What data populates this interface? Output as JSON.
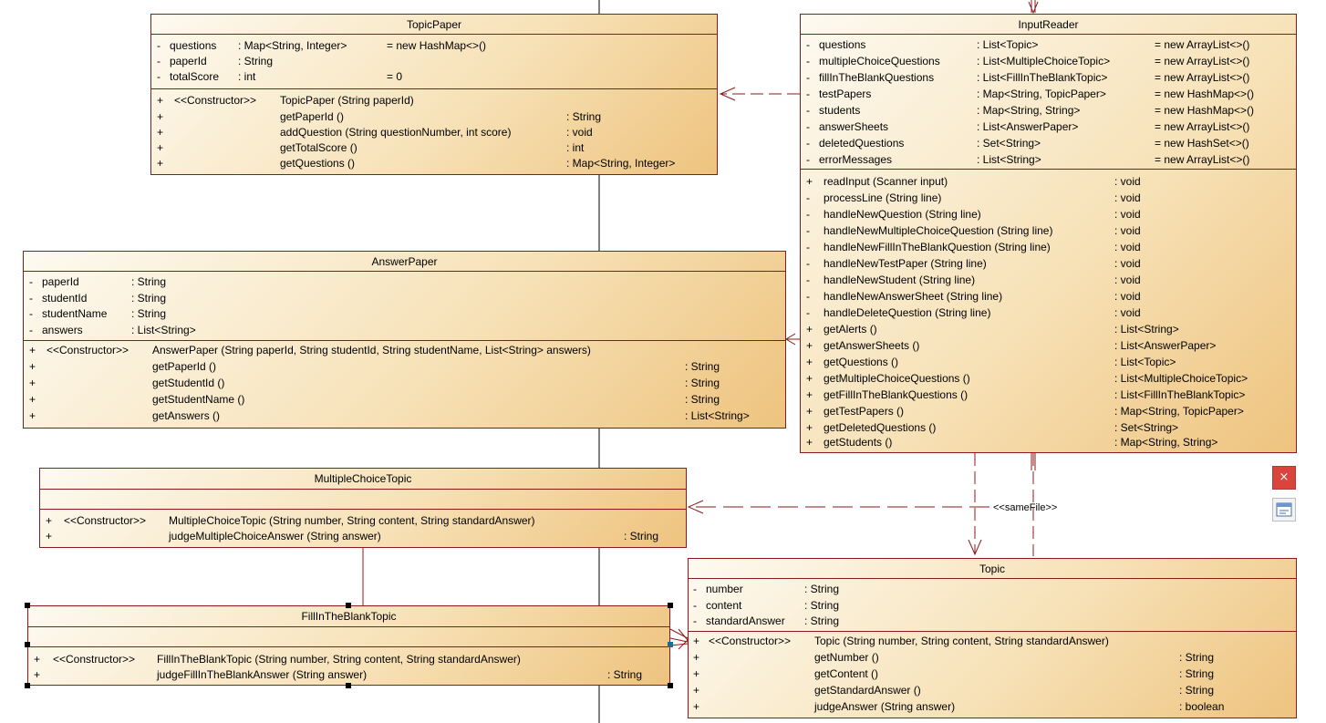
{
  "classes": {
    "topicpaper": {
      "name": "TopicPaper",
      "attributes": [
        {
          "vis": "-",
          "name": "questions",
          "type": ": Map<String, Integer>",
          "init": "= new HashMap<>()"
        },
        {
          "vis": "-",
          "name": "paperId",
          "type": ": String",
          "init": ""
        },
        {
          "vis": "-",
          "name": "totalScore",
          "type": ": int",
          "init": "= 0"
        }
      ],
      "operations": [
        {
          "vis": "+",
          "stereo": "<<Constructor>>",
          "sig": "TopicPaper (String paperId)",
          "ret": ""
        },
        {
          "vis": "+",
          "stereo": "",
          "sig": "getPaperId ()",
          "ret": ": String"
        },
        {
          "vis": "+",
          "stereo": "",
          "sig": "addQuestion (String questionNumber, int score)",
          "ret": ": void"
        },
        {
          "vis": "+",
          "stereo": "",
          "sig": "getTotalScore ()",
          "ret": ": int"
        },
        {
          "vis": "+",
          "stereo": "",
          "sig": "getQuestions ()",
          "ret": ": Map<String, Integer>"
        }
      ]
    },
    "inputreader": {
      "name": "InputReader",
      "attributes": [
        {
          "vis": "-",
          "name": "questions",
          "type": ": List<Topic>",
          "init": "= new ArrayList<>()"
        },
        {
          "vis": "-",
          "name": "multipleChoiceQuestions",
          "type": ": List<MultipleChoiceTopic>",
          "init": "= new ArrayList<>()"
        },
        {
          "vis": "-",
          "name": "fillInTheBlankQuestions",
          "type": ": List<FillInTheBlankTopic>",
          "init": "= new ArrayList<>()"
        },
        {
          "vis": "-",
          "name": "testPapers",
          "type": ": Map<String, TopicPaper>",
          "init": "= new HashMap<>()"
        },
        {
          "vis": "-",
          "name": "students",
          "type": ": Map<String, String>",
          "init": "= new HashMap<>()"
        },
        {
          "vis": "-",
          "name": "answerSheets",
          "type": ": List<AnswerPaper>",
          "init": "= new ArrayList<>()"
        },
        {
          "vis": "-",
          "name": "deletedQuestions",
          "type": ": Set<String>",
          "init": "= new HashSet<>()"
        },
        {
          "vis": "-",
          "name": "errorMessages",
          "type": ": List<String>",
          "init": "= new ArrayList<>()"
        }
      ],
      "operations": [
        {
          "vis": "+",
          "stereo": "",
          "sig": "readInput (Scanner input)",
          "ret": ": void"
        },
        {
          "vis": "-",
          "stereo": "",
          "sig": "processLine (String line)",
          "ret": ": void"
        },
        {
          "vis": "-",
          "stereo": "",
          "sig": "handleNewQuestion (String line)",
          "ret": ": void"
        },
        {
          "vis": "-",
          "stereo": "",
          "sig": "handleNewMultipleChoiceQuestion (String line)",
          "ret": ": void"
        },
        {
          "vis": "-",
          "stereo": "",
          "sig": "handleNewFillInTheBlankQuestion (String line)",
          "ret": ": void"
        },
        {
          "vis": "-",
          "stereo": "",
          "sig": "handleNewTestPaper (String line)",
          "ret": ": void"
        },
        {
          "vis": "-",
          "stereo": "",
          "sig": "handleNewStudent (String line)",
          "ret": ": void"
        },
        {
          "vis": "-",
          "stereo": "",
          "sig": "handleNewAnswerSheet (String line)",
          "ret": ": void"
        },
        {
          "vis": "-",
          "stereo": "",
          "sig": "handleDeleteQuestion (String line)",
          "ret": ": void"
        },
        {
          "vis": "+",
          "stereo": "",
          "sig": "getAlerts ()",
          "ret": ": List<String>"
        },
        {
          "vis": "+",
          "stereo": "",
          "sig": "getAnswerSheets ()",
          "ret": ": List<AnswerPaper>"
        },
        {
          "vis": "+",
          "stereo": "",
          "sig": "getQuestions ()",
          "ret": ": List<Topic>"
        },
        {
          "vis": "+",
          "stereo": "",
          "sig": "getMultipleChoiceQuestions ()",
          "ret": ": List<MultipleChoiceTopic>"
        },
        {
          "vis": "+",
          "stereo": "",
          "sig": "getFillInTheBlankQuestions ()",
          "ret": ": List<FillInTheBlankTopic>"
        },
        {
          "vis": "+",
          "stereo": "",
          "sig": "getTestPapers ()",
          "ret": ": Map<String, TopicPaper>"
        },
        {
          "vis": "+",
          "stereo": "",
          "sig": "getDeletedQuestions ()",
          "ret": ": Set<String>"
        },
        {
          "vis": "+",
          "stereo": "",
          "sig": "getStudents ()",
          "ret": ": Map<String, String>"
        }
      ]
    },
    "answerpaper": {
      "name": "AnswerPaper",
      "attributes": [
        {
          "vis": "-",
          "name": "paperId",
          "type": ": String",
          "init": ""
        },
        {
          "vis": "-",
          "name": "studentId",
          "type": ": String",
          "init": ""
        },
        {
          "vis": "-",
          "name": "studentName",
          "type": ": String",
          "init": ""
        },
        {
          "vis": "-",
          "name": "answers",
          "type": ": List<String>",
          "init": ""
        }
      ],
      "operations": [
        {
          "vis": "+",
          "stereo": "<<Constructor>>",
          "sig": "AnswerPaper (String paperId, String studentId, String studentName, List<String> answers)",
          "ret": ""
        },
        {
          "vis": "+",
          "stereo": "",
          "sig": "getPaperId ()",
          "ret": ": String"
        },
        {
          "vis": "+",
          "stereo": "",
          "sig": "getStudentId ()",
          "ret": ": String"
        },
        {
          "vis": "+",
          "stereo": "",
          "sig": "getStudentName ()",
          "ret": ": String"
        },
        {
          "vis": "+",
          "stereo": "",
          "sig": "getAnswers ()",
          "ret": ": List<String>"
        }
      ]
    },
    "multiplechoicetopic": {
      "name": "MultipleChoiceTopic",
      "attributes": [],
      "operations": [
        {
          "vis": "+",
          "stereo": "<<Constructor>>",
          "sig": "MultipleChoiceTopic (String number, String content, String standardAnswer)",
          "ret": ""
        },
        {
          "vis": "+",
          "stereo": "",
          "sig": "judgeMultipleChoiceAnswer (String answer)",
          "ret": ": String"
        }
      ]
    },
    "fillintheblanktopic": {
      "name": "FillInTheBlankTopic",
      "attributes": [],
      "operations": [
        {
          "vis": "+",
          "stereo": "<<Constructor>>",
          "sig": "FillInTheBlankTopic (String number, String content, String standardAnswer)",
          "ret": ""
        },
        {
          "vis": "+",
          "stereo": "",
          "sig": "judgeFillInTheBlankAnswer (String answer)",
          "ret": ": String"
        }
      ]
    },
    "topic": {
      "name": "Topic",
      "attributes": [
        {
          "vis": "-",
          "name": "number",
          "type": ": String",
          "init": ""
        },
        {
          "vis": "-",
          "name": "content",
          "type": ": String",
          "init": ""
        },
        {
          "vis": "-",
          "name": "standardAnswer",
          "type": ": String",
          "init": ""
        }
      ],
      "operations": [
        {
          "vis": "+",
          "stereo": "<<Constructor>>",
          "sig": "Topic (String number, String content, String standardAnswer)",
          "ret": ""
        },
        {
          "vis": "+",
          "stereo": "",
          "sig": "getNumber ()",
          "ret": ": String"
        },
        {
          "vis": "+",
          "stereo": "",
          "sig": "getContent ()",
          "ret": ": String"
        },
        {
          "vis": "+",
          "stereo": "",
          "sig": "getStandardAnswer ()",
          "ret": ": String"
        },
        {
          "vis": "+",
          "stereo": "",
          "sig": "judgeAnswer (String answer)",
          "ret": ": boolean"
        }
      ]
    }
  },
  "relation_labels": {
    "same_file": "<<sameFile>>"
  },
  "side_toolbar": {
    "close_glyph": "×",
    "close_icon": "close-icon",
    "panel_icon": "panel-icon"
  },
  "colors": {
    "line": "#8b1a1a",
    "class_fill_light": "#fdfaf1",
    "class_fill_dark": "#eec37e",
    "close_button": "#d9443d"
  }
}
